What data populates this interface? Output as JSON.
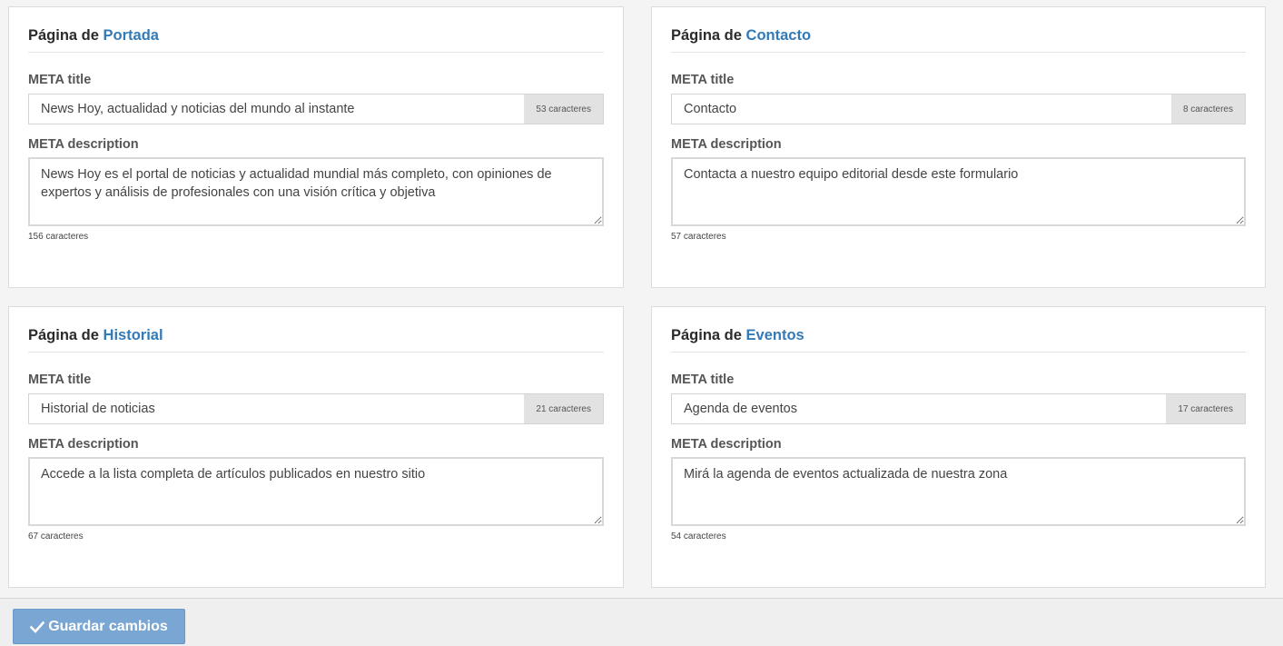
{
  "pages": [
    {
      "prefix": "Página de",
      "name": "Portada",
      "meta_title_label": "META title",
      "meta_title_value": "News Hoy, actualidad y noticias del mundo al instante",
      "meta_title_count": "53 caracteres",
      "meta_description_label": "META description",
      "meta_description_value": "News Hoy es el portal de noticias y actualidad mundial más completo, con opiniones de expertos y análisis de profesionales con una visión crítica y objetiva",
      "meta_description_count": "156 caracteres"
    },
    {
      "prefix": "Página de",
      "name": "Contacto",
      "meta_title_label": "META title",
      "meta_title_value": "Contacto",
      "meta_title_count": "8 caracteres",
      "meta_description_label": "META description",
      "meta_description_value": "Contacta a nuestro equipo editorial desde este formulario",
      "meta_description_count": "57 caracteres"
    },
    {
      "prefix": "Página de",
      "name": "Historial",
      "meta_title_label": "META title",
      "meta_title_value": "Historial de noticias",
      "meta_title_count": "21 caracteres",
      "meta_description_label": "META description",
      "meta_description_value": "Accede a la lista completa de artículos publicados en nuestro sitio",
      "meta_description_count": "67 caracteres"
    },
    {
      "prefix": "Página de",
      "name": "Eventos",
      "meta_title_label": "META title",
      "meta_title_value": "Agenda de eventos",
      "meta_title_count": "17 caracteres",
      "meta_description_label": "META description",
      "meta_description_value": "Mirá la agenda de eventos actualizada de nuestra zona",
      "meta_description_count": "54 caracteres"
    }
  ],
  "footer": {
    "save_label": "Guardar cambios",
    "save_icon": "check-icon"
  },
  "colors": {
    "accent": "#337ab7",
    "save_button": "#7aa6d3"
  }
}
